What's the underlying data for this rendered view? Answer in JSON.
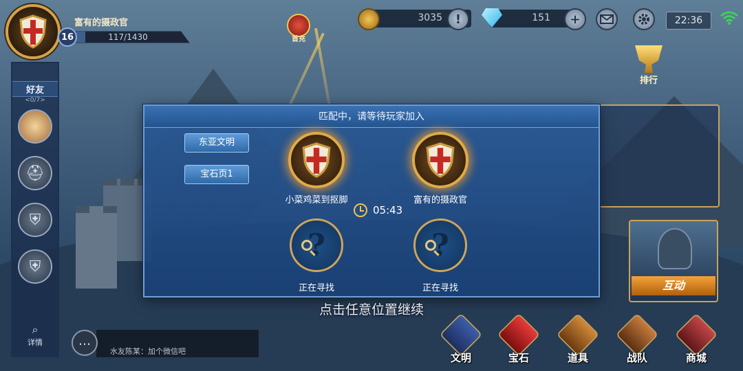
{
  "top_bar": {
    "player_name": "富有的摄政官",
    "level": "16",
    "xp_text": "117/1430",
    "xp_progress": 0.082,
    "first_charge_label": "首充",
    "gold": "3035",
    "gems": "151",
    "clock": "22:36",
    "rank_label": "排行"
  },
  "sidebar": {
    "title": "好友",
    "count": "<0/7>",
    "detail_label": "详情"
  },
  "modal": {
    "title": "匹配中，请等待玩家加入",
    "tags": [
      "东亚文明",
      "宝石页1"
    ],
    "players": [
      {
        "name": "小菜鸡菜到抠脚"
      },
      {
        "name": "富有的摄政官"
      }
    ],
    "searching": [
      {
        "status": "正在寻找"
      },
      {
        "status": "正在寻找"
      }
    ],
    "timer": "05:43"
  },
  "continue_hint": "点击任意位置继续",
  "chat": {
    "message": "水友陈某：加个微信吧"
  },
  "right_panel": {
    "interact_label": "互动"
  },
  "bottom_nav": [
    {
      "label": "文明",
      "icon": "banner-icon"
    },
    {
      "label": "宝石",
      "icon": "gem-icon"
    },
    {
      "label": "道具",
      "icon": "chest-icon"
    },
    {
      "label": "战队",
      "icon": "helmet-icon"
    },
    {
      "label": "商城",
      "icon": "shop-icon"
    }
  ],
  "colors": {
    "modal_bg": "#2a5a96",
    "accent_gold": "#e0ab45",
    "button_blue": "#3f7fc0"
  }
}
